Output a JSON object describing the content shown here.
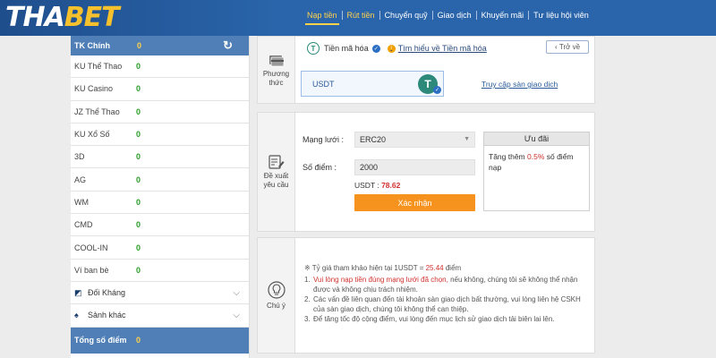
{
  "brand": {
    "logo_main": "THA",
    "logo_accent": "BET"
  },
  "nav": [
    "Nạp tiền",
    "Rút tiền",
    "Chuyển quỹ",
    "Giao dịch",
    "Khuyến mãi",
    "Tư liệu hội viên"
  ],
  "sidebar": {
    "main": {
      "label": "TK Chính",
      "value": "0"
    },
    "rows": [
      {
        "label": "KU Thể Thao",
        "value": "0"
      },
      {
        "label": "KU Casino",
        "value": "0"
      },
      {
        "label": "JZ Thể Thao",
        "value": "0"
      },
      {
        "label": "KU Xổ Số",
        "value": "0"
      },
      {
        "label": "3D",
        "value": "0"
      },
      {
        "label": "AG",
        "value": "0"
      },
      {
        "label": "WM",
        "value": "0"
      },
      {
        "label": "CMD",
        "value": "0"
      },
      {
        "label": "COOL-IN",
        "value": "0"
      },
      {
        "label": "Ví ban bè",
        "value": "0"
      }
    ],
    "toggles": [
      {
        "label": "Đối Kháng"
      },
      {
        "label": "Sảnh khác"
      }
    ],
    "total": {
      "label": "Tổng số điểm",
      "value": "0"
    }
  },
  "payment": {
    "side_label": "Phương thức",
    "method_title": "Tiền mã hóa",
    "info_link": "Tìm hiểu về Tiền mã hóa",
    "back_label": "Trở về",
    "card_label": "USDT",
    "coin_glyph": "T",
    "exchange_link": "Truy cập sàn giao dịch"
  },
  "request": {
    "side_label": "Đề xuất yêu cầu",
    "network_label": "Mạng lưới :",
    "network_value": "ERC20",
    "points_label": "Số điểm :",
    "points_value": "2000",
    "usdt_prefix": "USDT : ",
    "usdt_amount": "78.62",
    "confirm_label": "Xác nhận",
    "promo_title": "Ưu đãi",
    "promo_pre": "Tăng thêm ",
    "promo_pct": "0.5%",
    "promo_post": " số điểm nạp"
  },
  "notes": {
    "side_label": "Chú ý",
    "rate_pre": "※ Tỷ giá tham khảo hiện tại 1USDT = ",
    "rate_value": "25.44",
    "rate_post": " điểm",
    "items": [
      {
        "n": "1.",
        "red": "Vui lòng nạp tiền đúng mạng lưới đã chọn,",
        "text": " nếu không, chúng tôi sẽ không thể nhận được và không chịu trách nhiệm."
      },
      {
        "n": "2.",
        "red": "",
        "text": "Các vấn đề liên quan đến tài khoản sàn giao dịch bất thường, vui lòng liên hệ CSKH của sàn giao dịch, chúng tôi không thể can thiệp."
      },
      {
        "n": "3.",
        "red": "",
        "text": "Để tăng tốc độ cộng điểm, vui lòng đến mục lịch sử giao dịch tải biên lai lên."
      }
    ]
  }
}
